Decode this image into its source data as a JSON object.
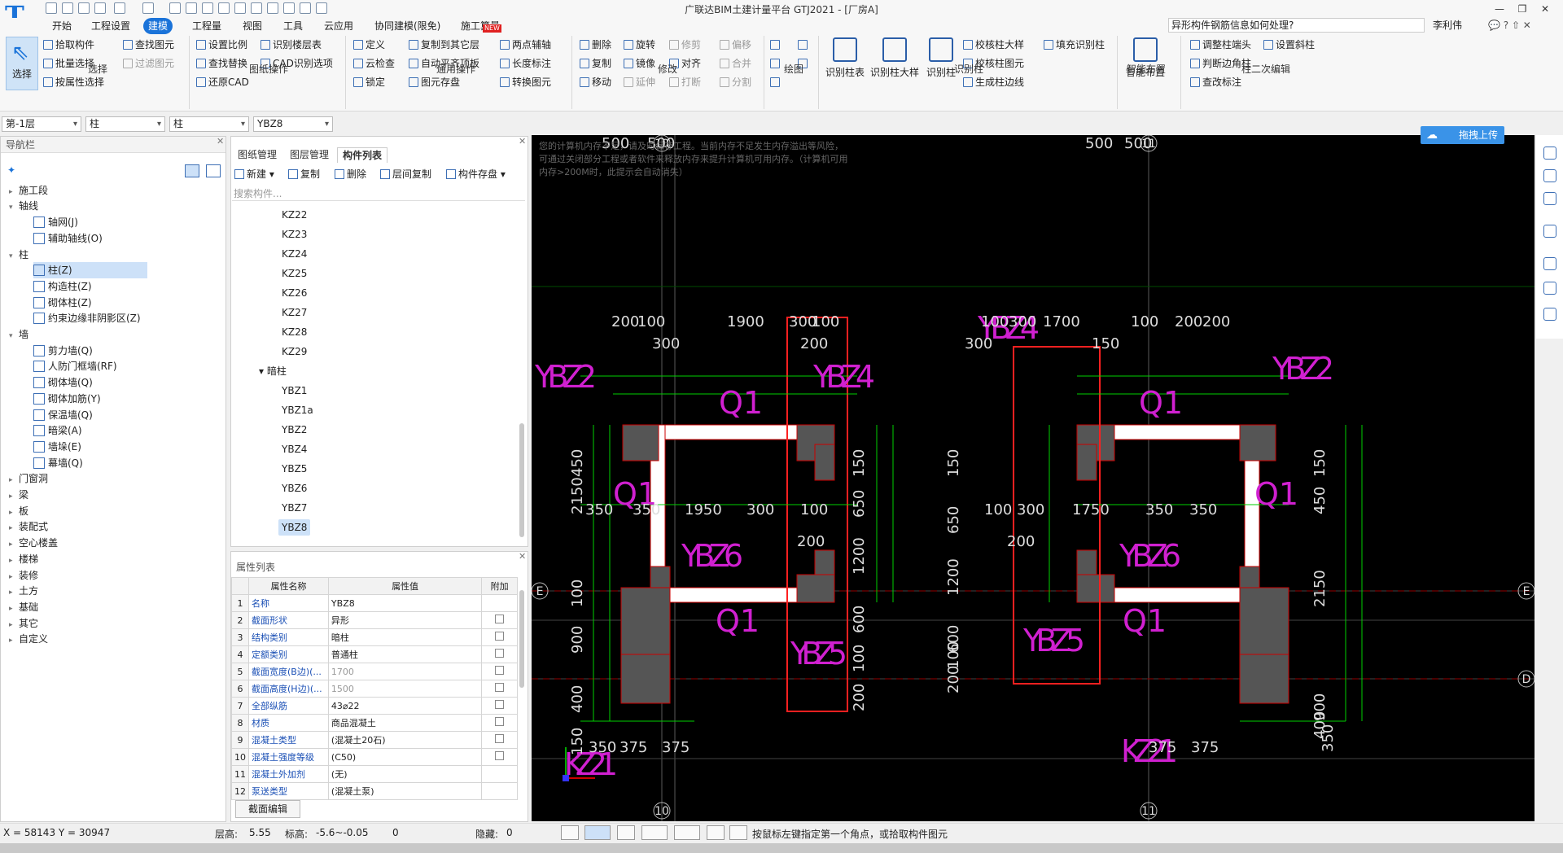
{
  "app": {
    "title": "广联达BIM土建计量平台 GTJ2021 - [厂房A]",
    "logo": "T"
  },
  "window": {
    "min": "—",
    "restore": "❐",
    "close": "✕"
  },
  "menu": {
    "tabs": [
      "开始",
      "工程设置",
      "建模",
      "工程量",
      "视图",
      "工具",
      "云应用",
      "协同建模(限免)",
      "施工算量"
    ],
    "active": "建模",
    "new_badge": "NEW"
  },
  "help": {
    "search": "异形构件钢筋信息如何处理?",
    "user": "李利伟",
    "help_icons": "💬 ? ⇧ ✕"
  },
  "ribbon": {
    "select": {
      "label": "选择",
      "items": [
        "拾取构件",
        "批量选择",
        "按属性选择",
        "查找图元",
        "过滤图元"
      ],
      "group": "选择"
    },
    "drawing": {
      "items": [
        "设置比例",
        "识别楼层表",
        "查找替换",
        "CAD识别选项",
        "还原CAD"
      ],
      "group": "图纸操作"
    },
    "general": {
      "items": [
        "定义",
        "复制到其它层",
        "两点辅轴",
        "云检查",
        "自动平齐顶板",
        "长度标注",
        "锁定",
        "图元存盘",
        "转换图元"
      ],
      "group": "通用操作"
    },
    "modify": {
      "items": [
        "删除",
        "旋转",
        "修剪",
        "偏移",
        "复制",
        "镜像",
        "对齐",
        "合并",
        "移动",
        "延伸",
        "打断",
        "分割"
      ],
      "group": "修改"
    },
    "draw": {
      "group": "绘图"
    },
    "recognize": {
      "big": [
        "识别柱表",
        "识别柱大样",
        "识别柱"
      ],
      "items": [
        "校核柱大样",
        "填充识别柱",
        "校核柱图元",
        "生成柱边线"
      ],
      "group": "识别柱"
    },
    "smart": {
      "label": "智能布置",
      "group": "智能布置"
    },
    "second": {
      "items": [
        "调整柱端头",
        "设置斜柱",
        "判断边角柱",
        "查改标注"
      ],
      "group": "柱二次编辑"
    }
  },
  "filters": [
    "第-1层",
    "柱",
    "柱",
    "YBZ8"
  ],
  "nav": {
    "title": "导航栏",
    "items": [
      {
        "label": "施工段",
        "lvl": 0,
        "tri": "▸"
      },
      {
        "label": "轴线",
        "lvl": 0,
        "tri": "▾"
      },
      {
        "label": "轴网(J)",
        "lvl": 1
      },
      {
        "label": "辅助轴线(O)",
        "lvl": 1
      },
      {
        "label": "柱",
        "lvl": 0,
        "tri": "▾"
      },
      {
        "label": "柱(Z)",
        "lvl": 1,
        "sel": true
      },
      {
        "label": "构造柱(Z)",
        "lvl": 1
      },
      {
        "label": "砌体柱(Z)",
        "lvl": 1
      },
      {
        "label": "约束边缘非阴影区(Z)",
        "lvl": 1
      },
      {
        "label": "墙",
        "lvl": 0,
        "tri": "▾"
      },
      {
        "label": "剪力墙(Q)",
        "lvl": 1
      },
      {
        "label": "人防门框墙(RF)",
        "lvl": 1
      },
      {
        "label": "砌体墙(Q)",
        "lvl": 1
      },
      {
        "label": "砌体加筋(Y)",
        "lvl": 1
      },
      {
        "label": "保温墙(Q)",
        "lvl": 1
      },
      {
        "label": "暗梁(A)",
        "lvl": 1
      },
      {
        "label": "墙垛(E)",
        "lvl": 1
      },
      {
        "label": "幕墙(Q)",
        "lvl": 1
      },
      {
        "label": "门窗洞",
        "lvl": 0,
        "tri": "▸"
      },
      {
        "label": "梁",
        "lvl": 0,
        "tri": "▸"
      },
      {
        "label": "板",
        "lvl": 0,
        "tri": "▸"
      },
      {
        "label": "装配式",
        "lvl": 0,
        "tri": "▸"
      },
      {
        "label": "空心楼盖",
        "lvl": 0,
        "tri": "▸"
      },
      {
        "label": "楼梯",
        "lvl": 0,
        "tri": "▸"
      },
      {
        "label": "装修",
        "lvl": 0,
        "tri": "▸"
      },
      {
        "label": "土方",
        "lvl": 0,
        "tri": "▸"
      },
      {
        "label": "基础",
        "lvl": 0,
        "tri": "▸"
      },
      {
        "label": "其它",
        "lvl": 0,
        "tri": "▸"
      },
      {
        "label": "自定义",
        "lvl": 0,
        "tri": "▸"
      }
    ]
  },
  "panel": {
    "tabs": [
      "图纸管理",
      "图层管理",
      "构件列表"
    ],
    "active": "构件列表",
    "toolbar": [
      "新建",
      "复制",
      "删除",
      "层间复制",
      "构件存盘"
    ],
    "search_placeholder": "搜索构件...",
    "components": [
      "KZ22",
      "KZ23",
      "KZ24",
      "KZ25",
      "KZ26",
      "KZ27",
      "KZ28",
      "KZ29"
    ],
    "group": "暗柱",
    "hidden": [
      "YBZ1",
      "YBZ1a",
      "YBZ2",
      "YBZ4",
      "YBZ5",
      "YBZ6",
      "YBZ7",
      "YBZ8"
    ],
    "selected": "YBZ8"
  },
  "props": {
    "title": "属性列表",
    "headers": [
      "属性名称",
      "属性值",
      "附加"
    ],
    "rows": [
      {
        "n": "1",
        "k": "名称",
        "v": "YBZ8",
        "cb": false
      },
      {
        "n": "2",
        "k": "截面形状",
        "v": "异形",
        "cb": true
      },
      {
        "n": "3",
        "k": "结构类别",
        "v": "暗柱",
        "cb": true
      },
      {
        "n": "4",
        "k": "定额类别",
        "v": "普通柱",
        "cb": true
      },
      {
        "n": "5",
        "k": "截面宽度(B边)(...",
        "v": "1700",
        "cb": true,
        "gray": true
      },
      {
        "n": "6",
        "k": "截面高度(H边)(...",
        "v": "1500",
        "cb": true,
        "gray": true
      },
      {
        "n": "7",
        "k": "全部纵筋",
        "v": "43⌀22",
        "cb": true
      },
      {
        "n": "8",
        "k": "材质",
        "v": "商品混凝土",
        "cb": true
      },
      {
        "n": "9",
        "k": "混凝土类型",
        "v": "(混凝土20石)",
        "cb": true
      },
      {
        "n": "10",
        "k": "混凝土强度等级",
        "v": "(C50)",
        "cb": true
      },
      {
        "n": "11",
        "k": "混凝土外加剂",
        "v": "(无)",
        "cb": false
      },
      {
        "n": "12",
        "k": "泵送类型",
        "v": "(混凝土泵)",
        "cb": false
      }
    ],
    "button": "截面编辑"
  },
  "canvas": {
    "warning": "您的计算机内存不足，请及时保存工程。当前内存不足发生内存溢出等风险，可通过关闭部分工程或者软件来释放内存来提升计算机可用内存。（计算机可用内存>200M时，此提示会自动消失）",
    "upload": "拖拽上传",
    "labels": {
      "YBZ2a": "YBZ2",
      "YBZ4a": "YBZ4",
      "YBZ4b": "YBZ4",
      "YBZ2b": "YBZ2",
      "Q1a": "Q1",
      "Q1b": "Q1",
      "Q1c": "Q1",
      "Q1d": "Q1",
      "Q1e": "Q1",
      "Q1f": "Q1",
      "YBZ6a": "YBZ6",
      "YBZ6b": "YBZ6",
      "YBZ5a": "YBZ5",
      "YBZ5b": "YBZ5",
      "KZ21a": "KZ21",
      "KZ21b": "KZ21"
    },
    "axes": {
      "a10": "10",
      "a11": "11",
      "aE": "E",
      "aD": "D"
    },
    "dims": [
      "500",
      "500",
      "500",
      "500",
      "200",
      "100",
      "1900",
      "300",
      "100",
      "300",
      "200",
      "100",
      "300",
      "1700",
      "100",
      "200",
      "200",
      "300",
      "150",
      "450",
      "2150",
      "100",
      "900",
      "400",
      "150",
      "150",
      "650",
      "1200",
      "600",
      "100",
      "200",
      "150",
      "650",
      "1200",
      "600",
      "100",
      "200",
      "150",
      "450",
      "2150",
      "900",
      "400",
      "350",
      "350",
      "1950",
      "300",
      "100",
      "100",
      "300",
      "1750",
      "350",
      "350",
      "200",
      "200",
      "350",
      "375",
      "375",
      "375",
      "375",
      "350"
    ]
  },
  "status": {
    "coords": "X = 58143 Y = 30947",
    "floor_h_label": "层高:",
    "floor_h": "5.55",
    "elev_label": "标高:",
    "elev": "-5.6~-0.05",
    "zero": "0",
    "hidden_label": "隐藏:",
    "hidden": "0",
    "hint": "按鼠标左键指定第一个角点，或拾取构件图元"
  },
  "colors": {
    "accent": "#1a73d9",
    "canvas_bg": "#000000",
    "dim_green": "#00d000",
    "label_magenta": "#d020d0",
    "select_red": "#ff2020"
  }
}
